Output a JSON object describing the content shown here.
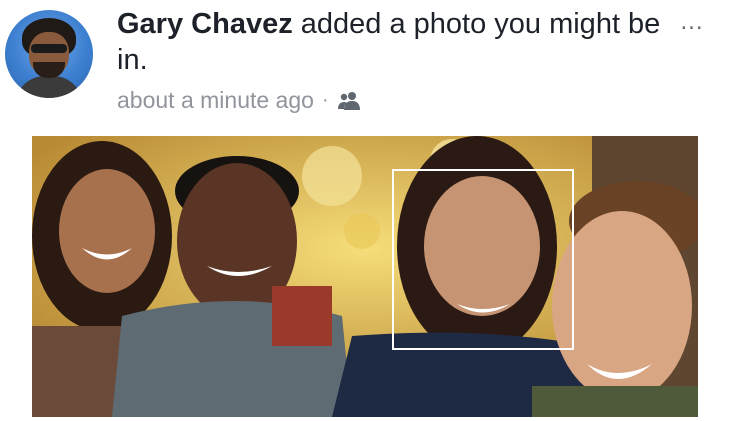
{
  "post": {
    "author": "Gary Chavez",
    "action": " added a photo you might be in.",
    "timestamp": "about a minute ago",
    "separator": "·",
    "audience_icon": "friends-icon",
    "more_label": "..."
  },
  "photo": {
    "icon": "photo",
    "face_tag_box": true
  },
  "colors": {
    "text_primary": "#1d2129",
    "text_secondary": "#90949c",
    "background": "#ffffff",
    "tag_box": "#ffffff"
  }
}
